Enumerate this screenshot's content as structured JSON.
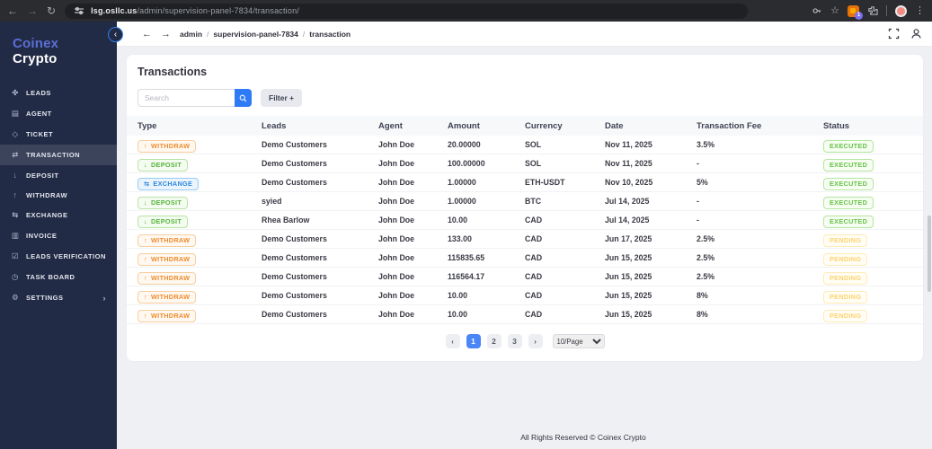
{
  "colors": {
    "sidebar_bg": "#222b45",
    "brand_accent": "#5b6fd6",
    "primary_blue": "#2f7bf6",
    "pagination_active": "#4a86f7",
    "withdraw": "#f08c2e",
    "deposit": "#56b53c",
    "exchange": "#2e86de",
    "executed": "#67c14a",
    "pending": "#ffc94d"
  },
  "browser": {
    "url_domain": "lsg.osllc.us",
    "url_path": "/admin/supervision-panel-7834/transaction/",
    "extension_badge": "1",
    "back": "←",
    "forward": "→",
    "reload": "↻",
    "bookmark": "☆",
    "menu": "⋮"
  },
  "sidebar": {
    "brand_primary": "Coinex",
    "brand_secondary": "Crypto",
    "chevron": "›",
    "items": [
      {
        "label": "LEADS",
        "glyph": "✤",
        "icon": "leads-icon",
        "active": false
      },
      {
        "label": "AGENT",
        "glyph": "▤",
        "icon": "agent-icon",
        "active": false
      },
      {
        "label": "TICKET",
        "glyph": "◇",
        "icon": "ticket-icon",
        "active": false
      },
      {
        "label": "TRANSACTION",
        "glyph": "⇄",
        "icon": "transaction-icon",
        "active": true
      },
      {
        "label": "DEPOSIT",
        "glyph": "↓",
        "icon": "deposit-icon",
        "active": false
      },
      {
        "label": "WITHDRAW",
        "glyph": "↑",
        "icon": "withdraw-icon",
        "active": false
      },
      {
        "label": "EXCHANGE",
        "glyph": "⇆",
        "icon": "exchange-icon",
        "active": false
      },
      {
        "label": "INVOICE",
        "glyph": "▥",
        "icon": "invoice-icon",
        "active": false
      },
      {
        "label": "LEADS VERIFICATION",
        "glyph": "☑",
        "icon": "leads-verification-icon",
        "active": false
      },
      {
        "label": "TASK BOARD",
        "glyph": "◷",
        "icon": "task-board-icon",
        "active": false
      },
      {
        "label": "SETTINGS",
        "glyph": "⚙",
        "icon": "settings-icon",
        "active": false,
        "chevron": true
      }
    ]
  },
  "topbar": {
    "collapse": "‹",
    "back": "←",
    "forward": "→",
    "separator": "/",
    "breadcrumb": [
      "admin",
      "supervision-panel-7834",
      "transaction"
    ]
  },
  "main": {
    "title": "Transactions",
    "search_placeholder": "Search",
    "filter_label": "Filter +",
    "table": {
      "columns": [
        "Type",
        "Leads",
        "Agent",
        "Amount",
        "Currency",
        "Date",
        "Transaction Fee",
        "Status"
      ],
      "type_icons": {
        "WITHDRAW": "↑",
        "DEPOSIT": "↓",
        "EXCHANGE": "⇆"
      },
      "rows": [
        {
          "type": "WITHDRAW",
          "leads": "Demo Customers",
          "agent": "John Doe",
          "amount": "20.00000",
          "currency": "SOL",
          "date": "Nov 11, 2025",
          "fee": "3.5%",
          "status": "EXECUTED"
        },
        {
          "type": "DEPOSIT",
          "leads": "Demo Customers",
          "agent": "John Doe",
          "amount": "100.00000",
          "currency": "SOL",
          "date": "Nov 11, 2025",
          "fee": "-",
          "status": "EXECUTED"
        },
        {
          "type": "EXCHANGE",
          "leads": "Demo Customers",
          "agent": "John Doe",
          "amount": "1.00000",
          "currency": "ETH-USDT",
          "date": "Nov 10, 2025",
          "fee": "5%",
          "status": "EXECUTED"
        },
        {
          "type": "DEPOSIT",
          "leads": "syied",
          "agent": "John Doe",
          "amount": "1.00000",
          "currency": "BTC",
          "date": "Jul 14, 2025",
          "fee": "-",
          "status": "EXECUTED"
        },
        {
          "type": "DEPOSIT",
          "leads": "Rhea Barlow",
          "agent": "John Doe",
          "amount": "10.00",
          "currency": "CAD",
          "date": "Jul 14, 2025",
          "fee": "-",
          "status": "EXECUTED"
        },
        {
          "type": "WITHDRAW",
          "leads": "Demo Customers",
          "agent": "John Doe",
          "amount": "133.00",
          "currency": "CAD",
          "date": "Jun 17, 2025",
          "fee": "2.5%",
          "status": "PENDING"
        },
        {
          "type": "WITHDRAW",
          "leads": "Demo Customers",
          "agent": "John Doe",
          "amount": "115835.65",
          "currency": "CAD",
          "date": "Jun 15, 2025",
          "fee": "2.5%",
          "status": "PENDING"
        },
        {
          "type": "WITHDRAW",
          "leads": "Demo Customers",
          "agent": "John Doe",
          "amount": "116564.17",
          "currency": "CAD",
          "date": "Jun 15, 2025",
          "fee": "2.5%",
          "status": "PENDING"
        },
        {
          "type": "WITHDRAW",
          "leads": "Demo Customers",
          "agent": "John Doe",
          "amount": "10.00",
          "currency": "CAD",
          "date": "Jun 15, 2025",
          "fee": "8%",
          "status": "PENDING"
        },
        {
          "type": "WITHDRAW",
          "leads": "Demo Customers",
          "agent": "John Doe",
          "amount": "10.00",
          "currency": "CAD",
          "date": "Jun 15, 2025",
          "fee": "8%",
          "status": "PENDING"
        }
      ]
    },
    "pagination": {
      "prev": "‹",
      "next": "›",
      "pages": [
        "1",
        "2",
        "3"
      ],
      "active_page": "1",
      "page_size": "10/Page"
    }
  },
  "footer": {
    "text": "All Rights Reserved © Coinex Crypto"
  }
}
